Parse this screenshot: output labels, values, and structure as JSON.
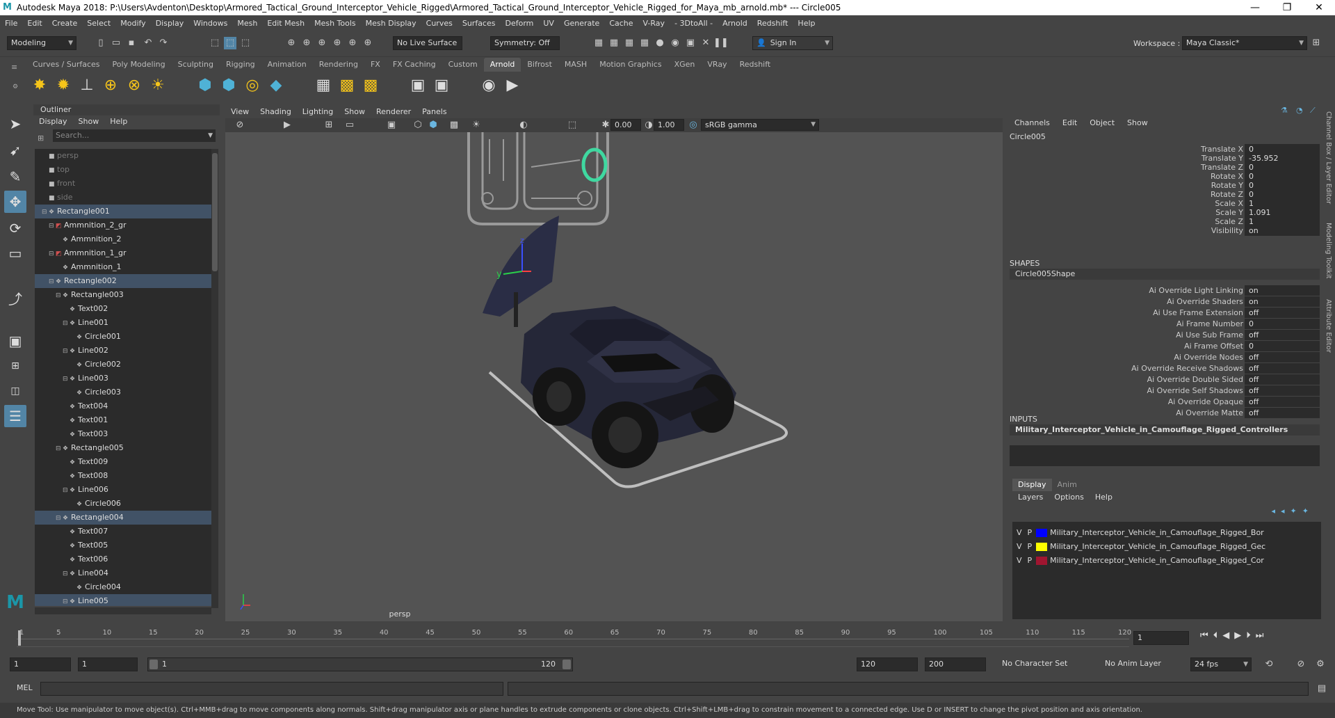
{
  "titlebar": {
    "text": "Autodesk Maya 2018: P:\\Users\\Avdenton\\Desktop\\Armored_Tactical_Ground_Interceptor_Vehicle_Rigged\\Armored_Tactical_Ground_Interceptor_Vehicle_Rigged_for_Maya_mb_arnold.mb*  ---  Circle005",
    "minimize": "—",
    "maximize": "❐",
    "close": "✕"
  },
  "menubar": [
    "File",
    "Edit",
    "Create",
    "Select",
    "Modify",
    "Display",
    "Windows",
    "Mesh",
    "Edit Mesh",
    "Mesh Tools",
    "Mesh Display",
    "Curves",
    "Surfaces",
    "Deform",
    "UV",
    "Generate",
    "Cache",
    "V-Ray",
    "- 3DtoAll -",
    "Arnold",
    "Redshift",
    "Help"
  ],
  "statusline": {
    "mode": "Modeling",
    "live_surface": "No Live Surface",
    "symmetry": "Symmetry: Off",
    "sign_in": "Sign In",
    "workspace_label": "Workspace :",
    "workspace": "Maya Classic*"
  },
  "shelf_tabs": [
    "Curves / Surfaces",
    "Poly Modeling",
    "Sculpting",
    "Rigging",
    "Animation",
    "Rendering",
    "FX",
    "FX Caching",
    "Custom",
    "Arnold",
    "Bifrost",
    "MASH",
    "Motion Graphics",
    "XGen",
    "VRay",
    "Redshift"
  ],
  "active_shelf": "Arnold",
  "outliner": {
    "title": "Outliner",
    "menu": [
      "Display",
      "Show",
      "Help"
    ],
    "search_placeholder": "Search...",
    "rows": [
      {
        "label": "persp",
        "indent": 0,
        "icon": "camera-icon",
        "dim": true,
        "sel": false,
        "exp": ""
      },
      {
        "label": "top",
        "indent": 0,
        "icon": "camera-icon",
        "dim": true,
        "sel": false,
        "exp": ""
      },
      {
        "label": "front",
        "indent": 0,
        "icon": "camera-icon",
        "dim": true,
        "sel": false,
        "exp": ""
      },
      {
        "label": "side",
        "indent": 0,
        "icon": "camera-icon",
        "dim": true,
        "sel": false,
        "exp": ""
      },
      {
        "label": "Rectangle001",
        "indent": 0,
        "icon": "transform-icon",
        "dim": false,
        "sel": true,
        "exp": "⊟"
      },
      {
        "label": "Ammnition_2_gr",
        "indent": 1,
        "icon": "group-icon",
        "dim": false,
        "sel": false,
        "exp": "⊟"
      },
      {
        "label": "Ammnition_2",
        "indent": 2,
        "icon": "transform-icon",
        "dim": false,
        "sel": false,
        "exp": ""
      },
      {
        "label": "Ammnition_1_gr",
        "indent": 1,
        "icon": "group-icon",
        "dim": false,
        "sel": false,
        "exp": "⊟"
      },
      {
        "label": "Ammnition_1",
        "indent": 2,
        "icon": "transform-icon",
        "dim": false,
        "sel": false,
        "exp": ""
      },
      {
        "label": "Rectangle002",
        "indent": 1,
        "icon": "transform-icon",
        "dim": false,
        "sel": true,
        "exp": "⊟"
      },
      {
        "label": "Rectangle003",
        "indent": 2,
        "icon": "transform-icon",
        "dim": false,
        "sel": false,
        "exp": "⊟"
      },
      {
        "label": "Text002",
        "indent": 3,
        "icon": "transform-icon",
        "dim": false,
        "sel": false,
        "exp": ""
      },
      {
        "label": "Line001",
        "indent": 3,
        "icon": "transform-icon",
        "dim": false,
        "sel": false,
        "exp": "⊟"
      },
      {
        "label": "Circle001",
        "indent": 4,
        "icon": "transform-icon",
        "dim": false,
        "sel": false,
        "exp": ""
      },
      {
        "label": "Line002",
        "indent": 3,
        "icon": "transform-icon",
        "dim": false,
        "sel": false,
        "exp": "⊟"
      },
      {
        "label": "Circle002",
        "indent": 4,
        "icon": "transform-icon",
        "dim": false,
        "sel": false,
        "exp": ""
      },
      {
        "label": "Line003",
        "indent": 3,
        "icon": "transform-icon",
        "dim": false,
        "sel": false,
        "exp": "⊟"
      },
      {
        "label": "Circle003",
        "indent": 4,
        "icon": "transform-icon",
        "dim": false,
        "sel": false,
        "exp": ""
      },
      {
        "label": "Text004",
        "indent": 3,
        "icon": "transform-icon",
        "dim": false,
        "sel": false,
        "exp": ""
      },
      {
        "label": "Text001",
        "indent": 3,
        "icon": "transform-icon",
        "dim": false,
        "sel": false,
        "exp": ""
      },
      {
        "label": "Text003",
        "indent": 3,
        "icon": "transform-icon",
        "dim": false,
        "sel": false,
        "exp": ""
      },
      {
        "label": "Rectangle005",
        "indent": 2,
        "icon": "transform-icon",
        "dim": false,
        "sel": false,
        "exp": "⊟"
      },
      {
        "label": "Text009",
        "indent": 3,
        "icon": "transform-icon",
        "dim": false,
        "sel": false,
        "exp": ""
      },
      {
        "label": "Text008",
        "indent": 3,
        "icon": "transform-icon",
        "dim": false,
        "sel": false,
        "exp": ""
      },
      {
        "label": "Line006",
        "indent": 3,
        "icon": "transform-icon",
        "dim": false,
        "sel": false,
        "exp": "⊟"
      },
      {
        "label": "Circle006",
        "indent": 4,
        "icon": "transform-icon",
        "dim": false,
        "sel": false,
        "exp": ""
      },
      {
        "label": "Rectangle004",
        "indent": 2,
        "icon": "transform-icon",
        "dim": false,
        "sel": true,
        "exp": "⊟"
      },
      {
        "label": "Text007",
        "indent": 3,
        "icon": "transform-icon",
        "dim": false,
        "sel": false,
        "exp": ""
      },
      {
        "label": "Text005",
        "indent": 3,
        "icon": "transform-icon",
        "dim": false,
        "sel": false,
        "exp": ""
      },
      {
        "label": "Text006",
        "indent": 3,
        "icon": "transform-icon",
        "dim": false,
        "sel": false,
        "exp": ""
      },
      {
        "label": "Line004",
        "indent": 3,
        "icon": "transform-icon",
        "dim": false,
        "sel": false,
        "exp": "⊟"
      },
      {
        "label": "Circle004",
        "indent": 4,
        "icon": "transform-icon",
        "dim": false,
        "sel": false,
        "exp": ""
      },
      {
        "label": "Line005",
        "indent": 3,
        "icon": "transform-icon",
        "dim": false,
        "sel": true,
        "exp": "⊟"
      }
    ]
  },
  "viewport": {
    "menu": [
      "View",
      "Shading",
      "Lighting",
      "Show",
      "Renderer",
      "Panels"
    ],
    "exposure": "0.00",
    "gamma": "1.00",
    "color_space": "sRGB gamma",
    "camera": "persp",
    "axis_z": "z",
    "axis_y": "y"
  },
  "channelbox": {
    "menu": [
      "Channels",
      "Edit",
      "Object",
      "Show"
    ],
    "object": "Circle005",
    "attrs": [
      {
        "name": "Translate X",
        "value": "0"
      },
      {
        "name": "Translate Y",
        "value": "-35.952"
      },
      {
        "name": "Translate Z",
        "value": "0"
      },
      {
        "name": "Rotate X",
        "value": "0"
      },
      {
        "name": "Rotate Y",
        "value": "0"
      },
      {
        "name": "Rotate Z",
        "value": "0"
      },
      {
        "name": "Scale X",
        "value": "1"
      },
      {
        "name": "Scale Y",
        "value": "1.091"
      },
      {
        "name": "Scale Z",
        "value": "1"
      },
      {
        "name": "Visibility",
        "value": "on"
      }
    ],
    "shapes_label": "SHAPES",
    "shape_name": "Circle005Shape",
    "shape_attrs": [
      {
        "name": "Ai Override Light Linking",
        "value": "on"
      },
      {
        "name": "Ai Override Shaders",
        "value": "on"
      },
      {
        "name": "Ai Use Frame Extension",
        "value": "off"
      },
      {
        "name": "Ai Frame Number",
        "value": "0"
      },
      {
        "name": "Ai Use Sub Frame",
        "value": "off"
      },
      {
        "name": "Ai Frame Offset",
        "value": "0"
      },
      {
        "name": "Ai Override Nodes",
        "value": "off"
      },
      {
        "name": "Ai Override Receive Shadows",
        "value": "off"
      },
      {
        "name": "Ai Override Double Sided",
        "value": "off"
      },
      {
        "name": "Ai Override Self Shadows",
        "value": "off"
      },
      {
        "name": "Ai Override Opaque",
        "value": "off"
      },
      {
        "name": "Ai Override Matte",
        "value": "off"
      }
    ],
    "inputs_label": "INPUTS",
    "input_name": "Military_Interceptor_Vehicle_in_Camouflage_Rigged_Controllers"
  },
  "layers": {
    "tabs": [
      "Display",
      "Anim"
    ],
    "menu": [
      "Layers",
      "Options",
      "Help"
    ],
    "rows": [
      {
        "v": "V",
        "p": "P",
        "color": "#0000ff",
        "name": "Military_Interceptor_Vehicle_in_Camouflage_Rigged_Bor"
      },
      {
        "v": "V",
        "p": "P",
        "color": "#ffff00",
        "name": "Military_Interceptor_Vehicle_in_Camouflage_Rigged_Gec"
      },
      {
        "v": "V",
        "p": "P",
        "color": "#a01530",
        "name": "Military_Interceptor_Vehicle_in_Camouflage_Rigged_Cor"
      }
    ]
  },
  "side_strip": [
    "Channel Box / Layer Editor",
    "Modeling Toolkit",
    "Attribute Editor"
  ],
  "timeline": {
    "ticks": [
      "1",
      "5",
      "10",
      "15",
      "20",
      "25",
      "30",
      "35",
      "40",
      "45",
      "50",
      "55",
      "60",
      "65",
      "70",
      "75",
      "80",
      "85",
      "90",
      "95",
      "100",
      "105",
      "110",
      "115",
      "120"
    ],
    "current_frame": "1"
  },
  "range": {
    "start": "1",
    "start2": "1",
    "slider_start": "1",
    "slider_end": "120",
    "end": "120",
    "end2": "200",
    "character_set": "No Character Set",
    "anim_layer": "No Anim Layer",
    "fps": "24 fps"
  },
  "mel": {
    "label": "MEL"
  },
  "helpline": "Move Tool: Use manipulator to move object(s). Ctrl+MMB+drag to move components along normals. Shift+drag manipulator axis or plane handles to extrude components or clone objects. Ctrl+Shift+LMB+drag to constrain movement to a connected edge. Use D or INSERT to change the pivot position and axis orientation."
}
